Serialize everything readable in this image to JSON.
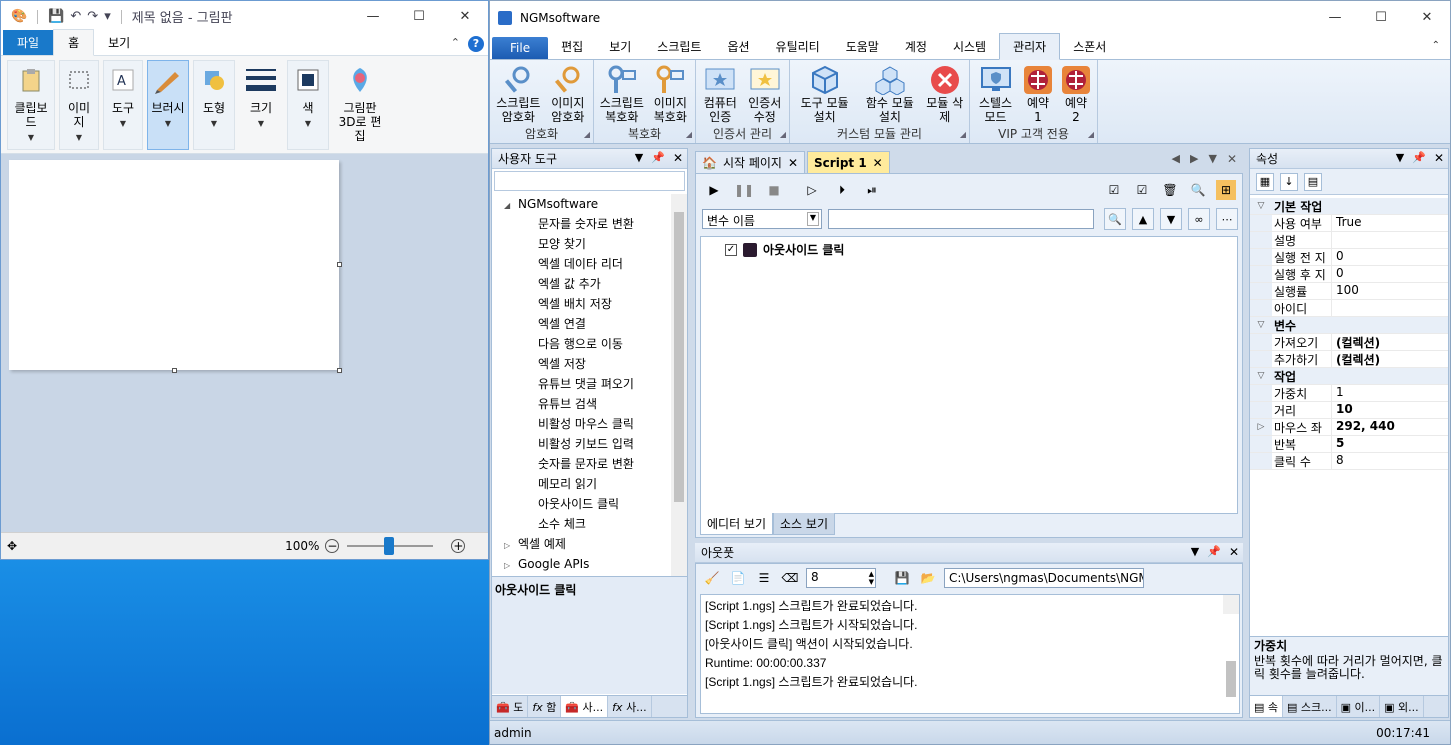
{
  "paint": {
    "title": "제목 없음 - 그림판",
    "tabs": [
      "파일",
      "홈",
      "보기"
    ],
    "groups": [
      {
        "label": "클립보드",
        "icon": "clipboard-icon"
      },
      {
        "label": "이미지",
        "icon": "image-select-icon"
      },
      {
        "label": "도구",
        "icon": "tools-icon"
      },
      {
        "label": "브러시",
        "icon": "brush-icon",
        "selected": true
      },
      {
        "label": "도형",
        "icon": "shapes-icon"
      },
      {
        "label": "크기",
        "icon": "line-size-icon"
      },
      {
        "label": "색",
        "icon": "color-icon"
      },
      {
        "label": "그림판 3D로 편집",
        "icon": "paint3d-icon"
      }
    ],
    "zoom": "100%"
  },
  "ngm": {
    "title": "NGMsoftware",
    "menu": [
      "File",
      "편집",
      "보기",
      "스크립트",
      "옵션",
      "유틸리티",
      "도움말",
      "계정",
      "시스템",
      "관리자",
      "스폰서"
    ],
    "active_menu": "관리자",
    "ribbon_groups": [
      {
        "name": "암호화",
        "buttons": [
          {
            "label": "스크립트 암호화",
            "icon": "script-encrypt-icon"
          },
          {
            "label": "이미지 암호화",
            "icon": "image-encrypt-icon"
          }
        ]
      },
      {
        "name": "복호화",
        "buttons": [
          {
            "label": "스크립트 복호화",
            "icon": "script-decrypt-icon"
          },
          {
            "label": "이미지 복호화",
            "icon": "image-decrypt-icon"
          }
        ]
      },
      {
        "name": "인증서 관리",
        "buttons": [
          {
            "label": "컴퓨터 인증",
            "icon": "computer-cert-icon"
          },
          {
            "label": "인증서 수정",
            "icon": "cert-edit-icon"
          }
        ]
      },
      {
        "name": "커스텀 모듈 관리",
        "buttons": [
          {
            "label": "도구 모듈 설치",
            "icon": "tool-module-icon"
          },
          {
            "label": "함수 모듈 설치",
            "icon": "function-module-icon"
          },
          {
            "label": "모듈 삭제",
            "icon": "module-delete-icon"
          }
        ]
      },
      {
        "name": "VIP 고객 전용",
        "buttons": [
          {
            "label": "스텔스 모드",
            "icon": "stealth-mode-icon"
          },
          {
            "label": "예약 1",
            "icon": "reserve-1-icon"
          },
          {
            "label": "예약 2",
            "icon": "reserve-2-icon"
          }
        ]
      }
    ],
    "tools_panel": {
      "title": "사용자 도구",
      "root": "NGMsoftware",
      "items": [
        "문자를 숫자로 변환",
        "모양 찾기",
        "엑셀 데이타 리더",
        "엑셀 값 추가",
        "엑셀 배치 저장",
        "엑셀 연결",
        "다음 행으로 이동",
        "엑셀 저장",
        "유튜브 댓글 펴오기",
        "유튜브 검색",
        "비활성 마우스 클릭",
        "비활성 키보드 입력",
        "숫자를 문자로 변환",
        "메모리 읽기",
        "아웃사이드 클릭",
        "소수 체크"
      ],
      "subnodes": [
        "엑셀 예제",
        "Google APIs"
      ],
      "description": "아웃사이드 클릭",
      "bottom_tabs": [
        "도",
        "함",
        "사...",
        "사..."
      ]
    },
    "doc_tabs": [
      "시작 페이지",
      "Script 1"
    ],
    "editor": {
      "var_select": "변수 이름",
      "action": "아웃사이드 클릭",
      "bottom_tabs": [
        "에디터 보기",
        "소스 보기"
      ]
    },
    "output": {
      "title": "아웃풋",
      "count": "8",
      "path": "C:\\Users\\ngmas\\Documents\\NGM6\\",
      "lines": [
        "[Script 1.ngs] 스크립트가 완료되었습니다.",
        "[Script 1.ngs] 스크립트가 시작되었습니다.",
        "[아웃사이드 클릭] 액션이 시작되었습니다.",
        "Runtime: 00:00:00.337",
        "[Script 1.ngs] 스크립트가 완료되었습니다."
      ]
    },
    "properties": {
      "title": "속성",
      "cat1": "기본 작업",
      "cat2": "변수",
      "cat3": "작업",
      "rows1": [
        {
          "k": "사용 여부",
          "v": "True"
        },
        {
          "k": "설명",
          "v": ""
        },
        {
          "k": "실행 전 지",
          "v": "0"
        },
        {
          "k": "실행 후 지",
          "v": "0"
        },
        {
          "k": "실행률",
          "v": "100"
        },
        {
          "k": "아이디",
          "v": ""
        }
      ],
      "rows2": [
        {
          "k": "가져오기",
          "v": "(컬렉션)"
        },
        {
          "k": "추가하기",
          "v": "(컬렉션)"
        }
      ],
      "rows3": [
        {
          "k": "가중치",
          "v": "1"
        },
        {
          "k": "거리",
          "v": "10"
        },
        {
          "k": "마우스 좌",
          "v": "292, 440"
        },
        {
          "k": "반복",
          "v": "5"
        },
        {
          "k": "클릭 수",
          "v": "8"
        }
      ],
      "desc_title": "가중치",
      "desc_text": "반복 횟수에 따라 거리가 멀어지면, 클릭 횟수를 늘려줍니다.",
      "bottom_tabs": [
        "속",
        "스크...",
        "이...",
        "외..."
      ]
    },
    "status": {
      "user": "admin",
      "time": "00:17:41"
    }
  }
}
